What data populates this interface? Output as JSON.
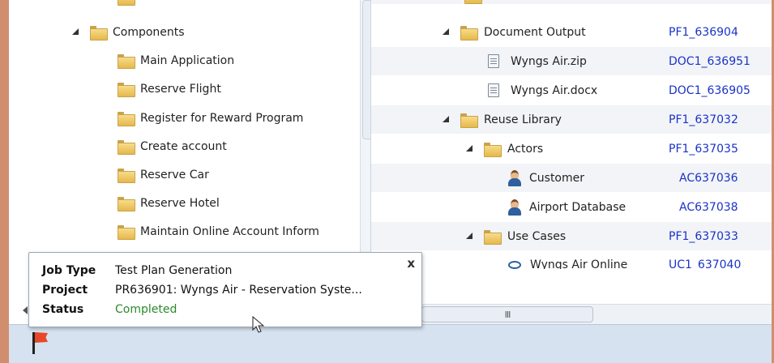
{
  "left_tree": {
    "group": {
      "label": "Components"
    },
    "items": [
      {
        "label": "Main Application"
      },
      {
        "label": "Reserve Flight"
      },
      {
        "label": "Register for Reward Program"
      },
      {
        "label": "Create account"
      },
      {
        "label": "Reserve Car"
      },
      {
        "label": "Reserve Hotel"
      },
      {
        "label": "Maintain Online Account Inform"
      }
    ]
  },
  "right_grid": {
    "rows": [
      {
        "label": "Document Output",
        "id": "PF1_636904",
        "icon": "folder-icon",
        "expand": true
      },
      {
        "label": "Wyngs Air.zip",
        "id": "DOC1_636951",
        "icon": "document-icon",
        "expand": false
      },
      {
        "label": "Wyngs Air.docx",
        "id": "DOC1_636905",
        "icon": "document-icon",
        "expand": false
      },
      {
        "label": "Reuse Library",
        "id": "PF1_637032",
        "icon": "folder-icon",
        "expand": true
      },
      {
        "label": "Actors",
        "id": "PF1_637035",
        "icon": "folder-icon",
        "expand": true
      },
      {
        "label": "Customer",
        "id": "AC637036",
        "icon": "actor-icon",
        "expand": false
      },
      {
        "label": "Airport Database",
        "id": "AC637038",
        "icon": "actor-icon",
        "expand": false
      },
      {
        "label": "Use Cases",
        "id": "PF1_637033",
        "icon": "folder-icon",
        "expand": true
      },
      {
        "label": "Wyngs Air Online",
        "id": "UC1_637040",
        "icon": "use-case-icon",
        "expand": false
      }
    ]
  },
  "horizontal_scroll": {
    "grip": "III"
  },
  "popup": {
    "job_type_label": "Job Type",
    "job_type_value": "Test Plan Generation",
    "project_label": "Project",
    "project_value": "PR636901: Wyngs Air - Reservation Syste...",
    "status_label": "Status",
    "status_value": "Completed",
    "close_label": "x"
  },
  "colors": {
    "accent_frame": "#d18e6f",
    "link": "#1a33c8",
    "status_ok": "#2a8a2a",
    "toolbar": "#d6e2f0",
    "flag": "#e8462a"
  }
}
